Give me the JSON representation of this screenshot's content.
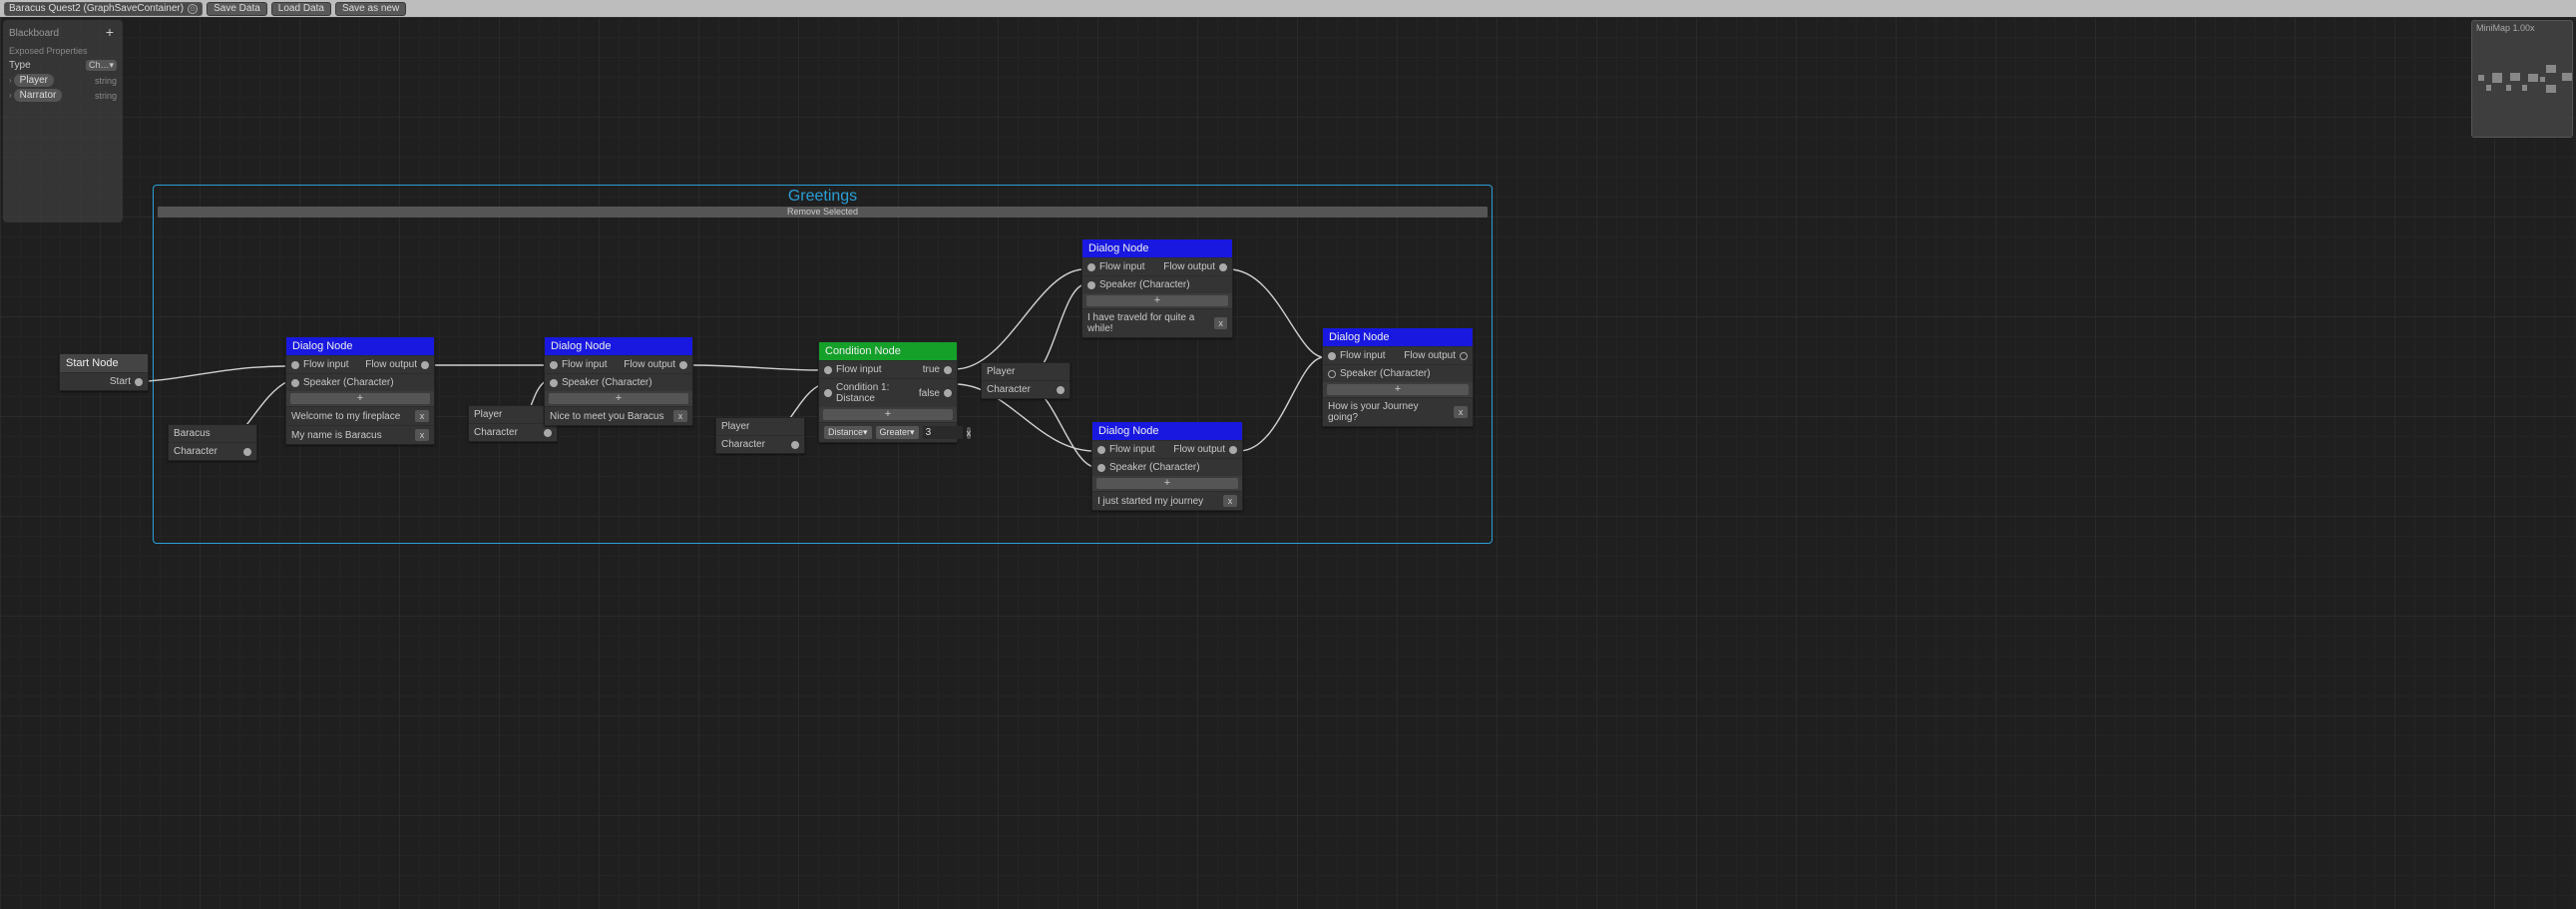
{
  "toolbar": {
    "asset_name": "Baracus Quest2 (GraphSaveContainer)",
    "save_label": "Save Data",
    "load_label": "Load Data",
    "saveas_label": "Save as new"
  },
  "blackboard": {
    "title": "Blackboard",
    "subtitle": "Exposed Properties",
    "col_type": "Type",
    "col_btn": "Ch…▾",
    "rows": [
      {
        "name": "Player",
        "type": "string"
      },
      {
        "name": "Narrator",
        "type": "string"
      }
    ]
  },
  "minimap": {
    "title": "MiniMap  1.00x"
  },
  "group": {
    "title": "Greetings",
    "bar": "Remove Selected"
  },
  "nodes": {
    "start": {
      "title": "Start Node",
      "out": "Start"
    },
    "baracus_token": {
      "label": "Baracus",
      "sub": "Character"
    },
    "player_token1": {
      "label": "Player",
      "sub": "Character"
    },
    "player_token2": {
      "label": "Player",
      "sub": "Character"
    },
    "char_token": {
      "label": "Character"
    },
    "dialog1": {
      "title": "Dialog Node",
      "in": "Flow input",
      "out": "Flow output",
      "speaker": "Speaker (Character)",
      "lines": [
        "Welcome to my fireplace",
        "My name is Baracus"
      ]
    },
    "dialog2": {
      "title": "Dialog Node",
      "in": "Flow input",
      "out": "Flow output",
      "speaker": "Speaker (Character)",
      "lines": [
        "Nice to meet you Baracus"
      ]
    },
    "cond": {
      "title": "Condition Node",
      "in": "Flow input",
      "true": "true",
      "false": "false",
      "cond_label": "Condition 1: Distance",
      "dd1": "Distance▾",
      "dd2": "Greater▾",
      "val": "3"
    },
    "dialog3": {
      "title": "Dialog Node",
      "in": "Flow input",
      "out": "Flow output",
      "speaker": "Speaker (Character)",
      "lines": [
        "I have traveld for quite a while!"
      ]
    },
    "dialog4": {
      "title": "Dialog Node",
      "in": "Flow input",
      "out": "Flow output",
      "speaker": "Speaker (Character)",
      "lines": [
        "I just started my journey"
      ]
    },
    "dialog5": {
      "title": "Dialog Node",
      "in": "Flow input",
      "out": "Flow output",
      "speaker": "Speaker (Character)",
      "lines": [
        "How is your Journey going?"
      ]
    }
  },
  "common": {
    "plus": "+",
    "x": "x"
  }
}
